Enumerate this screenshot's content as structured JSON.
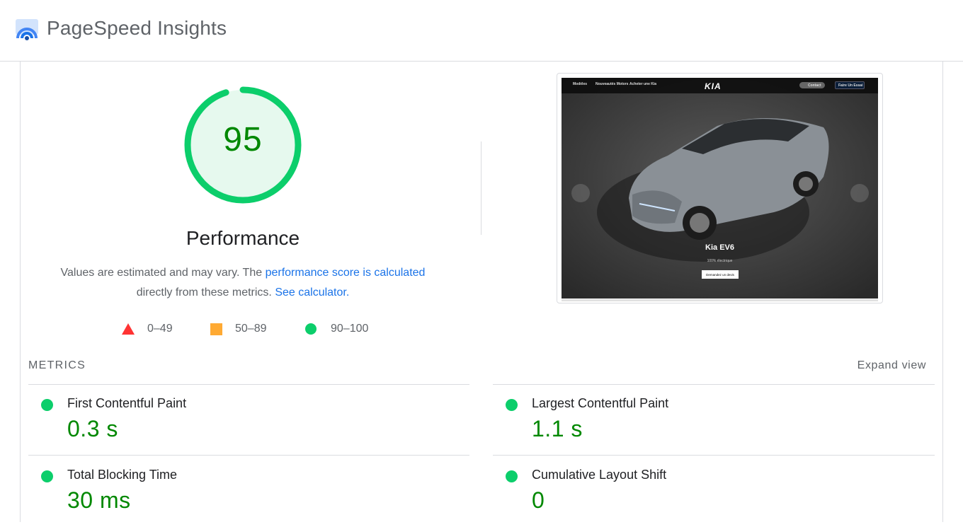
{
  "app": {
    "title": "PageSpeed Insights"
  },
  "performance": {
    "score": "95",
    "title": "Performance",
    "description_prefix": "Values are estimated and may vary. The ",
    "score_link": "performance score is calculated",
    "description_mid": "directly from these metrics. ",
    "calculator_link": "See calculator."
  },
  "legend": [
    {
      "label": "0–49",
      "color": "#ff3333",
      "shape": "triangle"
    },
    {
      "label": "50–89",
      "color": "#ffaa33",
      "shape": "square"
    },
    {
      "label": "90–100",
      "color": "#0cce6b",
      "shape": "circle"
    }
  ],
  "screenshot": {
    "nav": [
      "Modèles",
      "Nouveautés Motors",
      "Acheter une Kia"
    ],
    "brand": "KIA",
    "search_label": "Contact",
    "cta_button": "Faire Un Essai",
    "car_name": "Kia EV6",
    "car_sub": "100% électrique",
    "car_cta": "Demandez un devis"
  },
  "metrics": {
    "label": "METRICS",
    "expand_label": "Expand view",
    "items": [
      {
        "name": "First Contentful Paint",
        "value": "0.3 s"
      },
      {
        "name": "Largest Contentful Paint",
        "value": "1.1 s"
      },
      {
        "name": "Total Blocking Time",
        "value": "30 ms"
      },
      {
        "name": "Cumulative Layout Shift",
        "value": "0"
      }
    ]
  },
  "colors": {
    "pass": "#0cce6b",
    "pass_text": "#008800",
    "link": "#1a73e8"
  }
}
